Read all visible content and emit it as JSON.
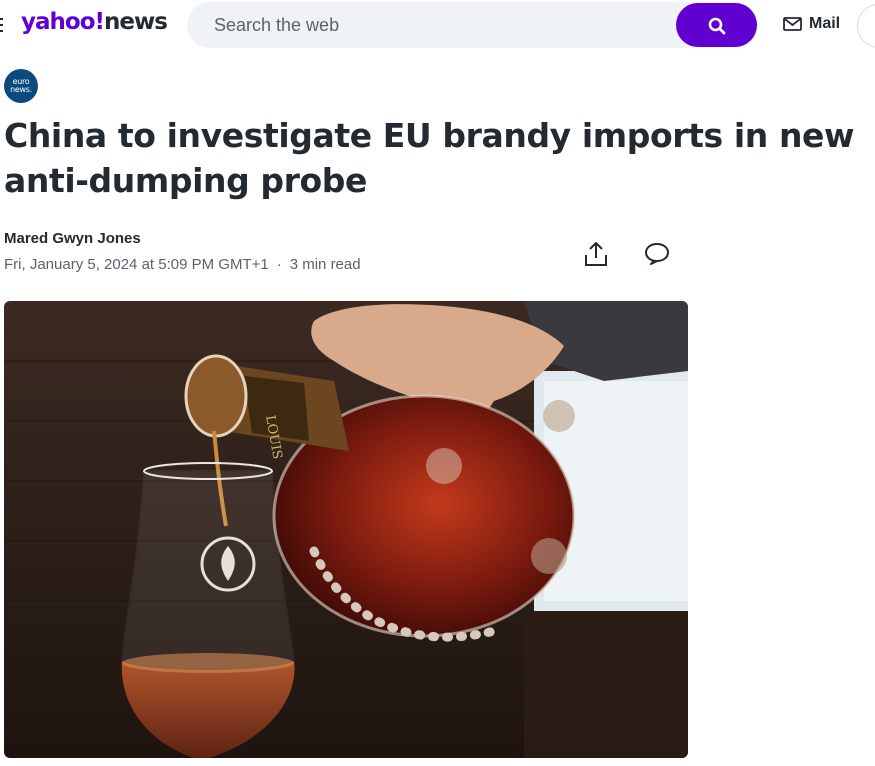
{
  "header": {
    "logo_primary": "yahoo!",
    "logo_secondary": "news",
    "search_placeholder": "Search the web",
    "search_icon": "search-icon",
    "mail_icon": "mail-icon",
    "mail_label": "Mail",
    "brand_color": "#6001d2"
  },
  "article": {
    "source_logo_text": "euro news.",
    "source_color": "#0a4a7f",
    "headline": "China to investigate EU brandy imports in new anti-dumping probe",
    "author": "Mared Gwyn Jones",
    "date": "Fri, January 5, 2024 at 5:09 PM GMT+1",
    "separator": "·",
    "read_time": "3 min read",
    "share_icon": "share-icon",
    "comment_icon": "comment-icon"
  },
  "image": {
    "subject": "hand-pouring-cognac-from-crystal-decanter-into-glass"
  }
}
